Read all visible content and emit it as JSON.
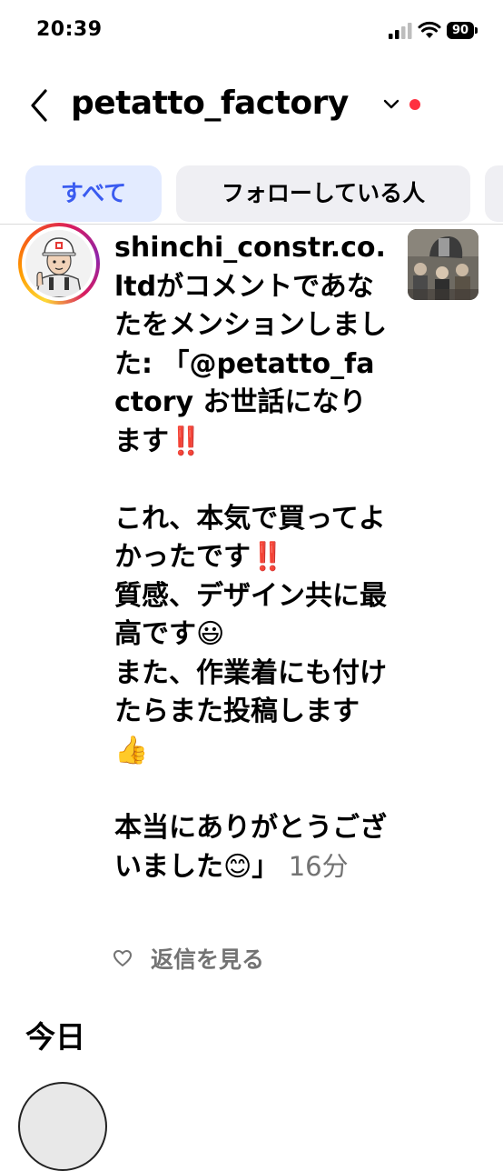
{
  "status_bar": {
    "time": "20:39",
    "battery": "90",
    "icons": [
      "signal-icon",
      "wifi-icon",
      "battery-icon"
    ]
  },
  "header": {
    "title": "petatto_factory",
    "back_icon": "chevron-left-icon",
    "dropdown_icon": "chevron-down-icon",
    "dot_color": "#ff3040"
  },
  "tabs": [
    {
      "label": "すべて",
      "active": true
    },
    {
      "label": "フォローしている人",
      "active": false
    },
    {
      "label": "",
      "active": false
    }
  ],
  "colors": {
    "active_tab_bg": "#e3ebff",
    "active_tab_text": "#3a5bf0",
    "tab_bg": "#efeff3",
    "secondary_text": "#737373"
  },
  "notification": {
    "username": "shinchi_constr.co.ltd",
    "action": "がコメントであなたをメンションしました: ",
    "comment_open": "「@petatto_factory お世話になります",
    "emoji_1": "‼️",
    "comment_mid_1": "\n\nこれ、本気で買ってよかったです",
    "emoji_2": "‼️",
    "comment_mid_2": "\n質感、デザイン共に最高です",
    "emoji_3": "😃",
    "comment_mid_3": "\nまた、作業着にも付けたらまた投稿します",
    "emoji_4": "👍",
    "comment_mid_4": "\n\n本当にありがとうございました",
    "emoji_5": "😊",
    "comment_close": "」",
    "time_ago": "16分",
    "view_replies": "返信を見る",
    "avatar_icon": "worker-avatar",
    "thumbnail_icon": "post-thumbnail"
  },
  "sections": {
    "today": "今日"
  }
}
